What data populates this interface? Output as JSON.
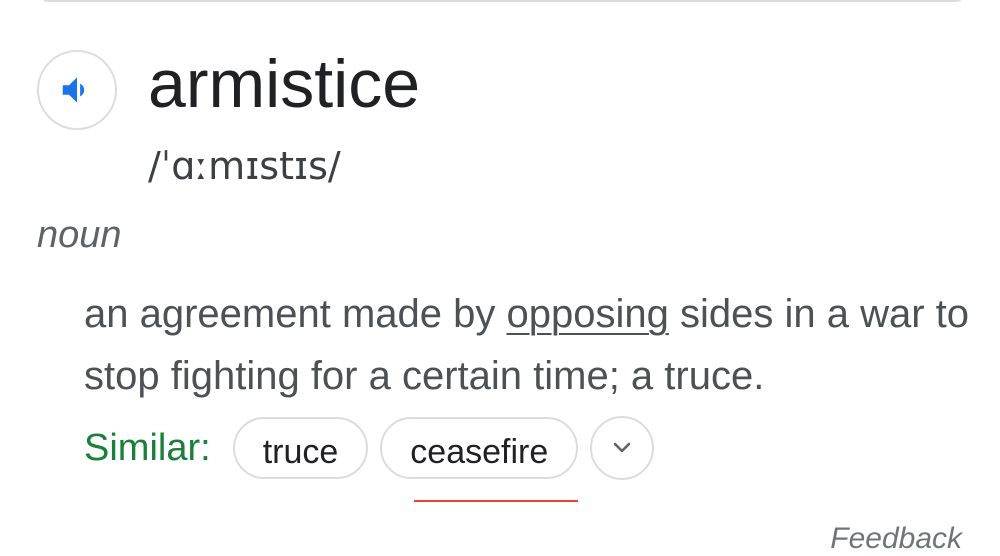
{
  "entry": {
    "word": "armistice",
    "pronunciation": "/ˈɑːmɪstɪs/",
    "part_of_speech": "noun",
    "audio_icon": "speaker-icon"
  },
  "definition": {
    "before_link": "an agreement made by ",
    "link": "opposing",
    "after_link": " sides in a war to stop fighting for a certain time; a truce."
  },
  "similar": {
    "label": "Similar:",
    "chips": [
      "truce",
      "ceasefire"
    ],
    "expand_icon": "chevron-down-icon"
  },
  "footer": {
    "feedback": "Feedback"
  },
  "colors": {
    "accent_blue": "#1a73e8",
    "similar_green": "#188038",
    "underline_red": "#ea4335"
  }
}
